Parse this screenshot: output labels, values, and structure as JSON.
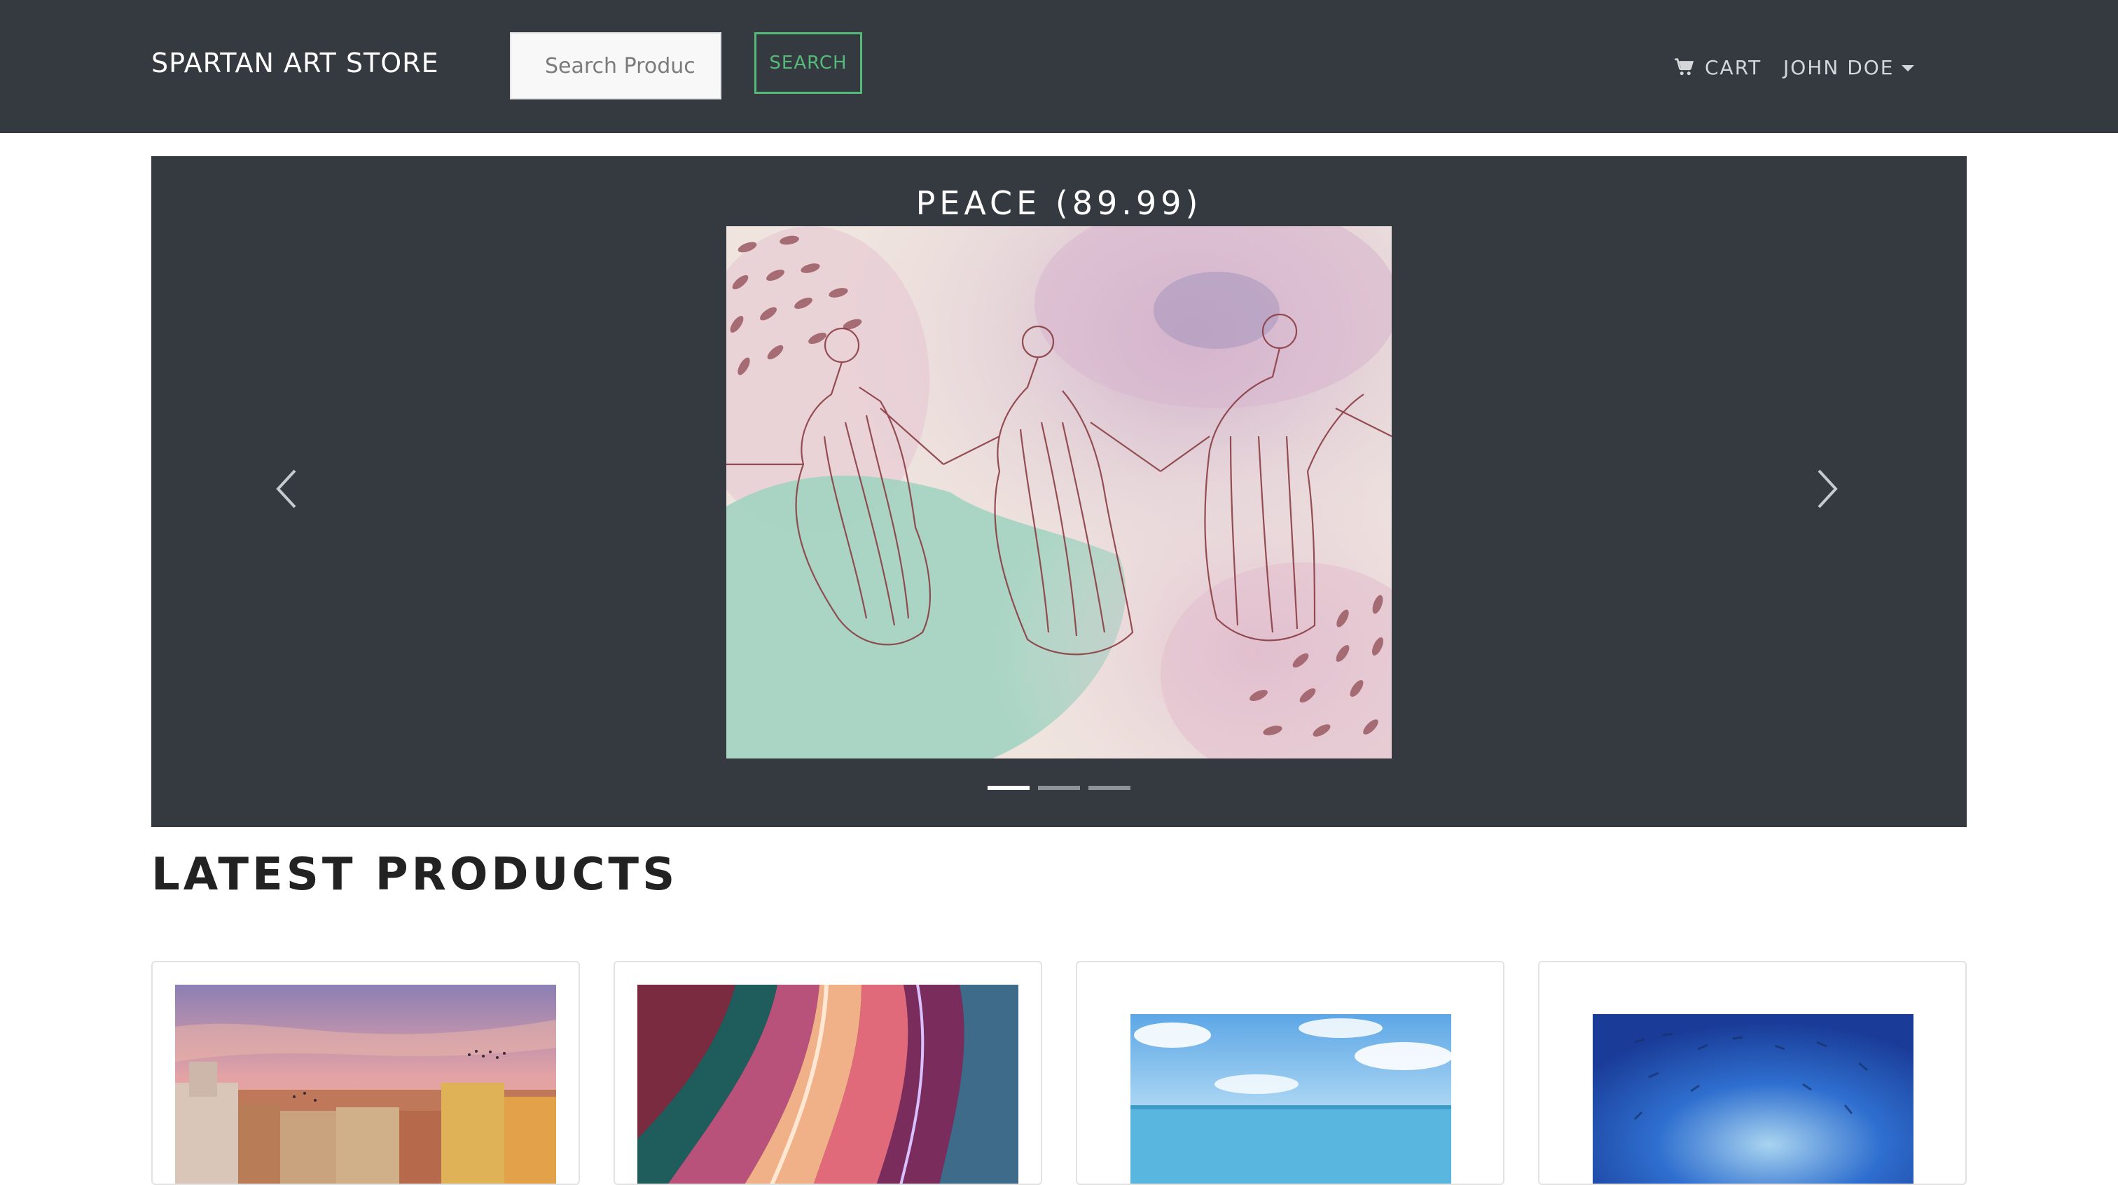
{
  "navbar": {
    "brand": "SPARTAN ART STORE",
    "search_placeholder": "Search Produc",
    "search_button": "SEARCH",
    "cart_label": "CART",
    "cart_icon": "cart-icon",
    "user_label": "JOHN DOE",
    "user_icon": "caret-down-icon"
  },
  "carousel": {
    "caption": "PEACE (89.99)",
    "slide_count": 3,
    "active_slide": 1,
    "prev_icon": "chevron-left-icon",
    "next_icon": "chevron-right-icon"
  },
  "latest_products": {
    "title": "LATEST PRODUCTS",
    "cards": [
      {
        "thumb": "venice-sunset-image"
      },
      {
        "thumb": "fluid-marble-image"
      },
      {
        "thumb": "sea-watercolor-image"
      },
      {
        "thumb": "blue-fish-swirl-image"
      }
    ]
  },
  "colors": {
    "navbar_bg": "#343a40",
    "carousel_bg": "#343a40",
    "accent_green": "#55b97a",
    "text_dark": "#222222"
  }
}
